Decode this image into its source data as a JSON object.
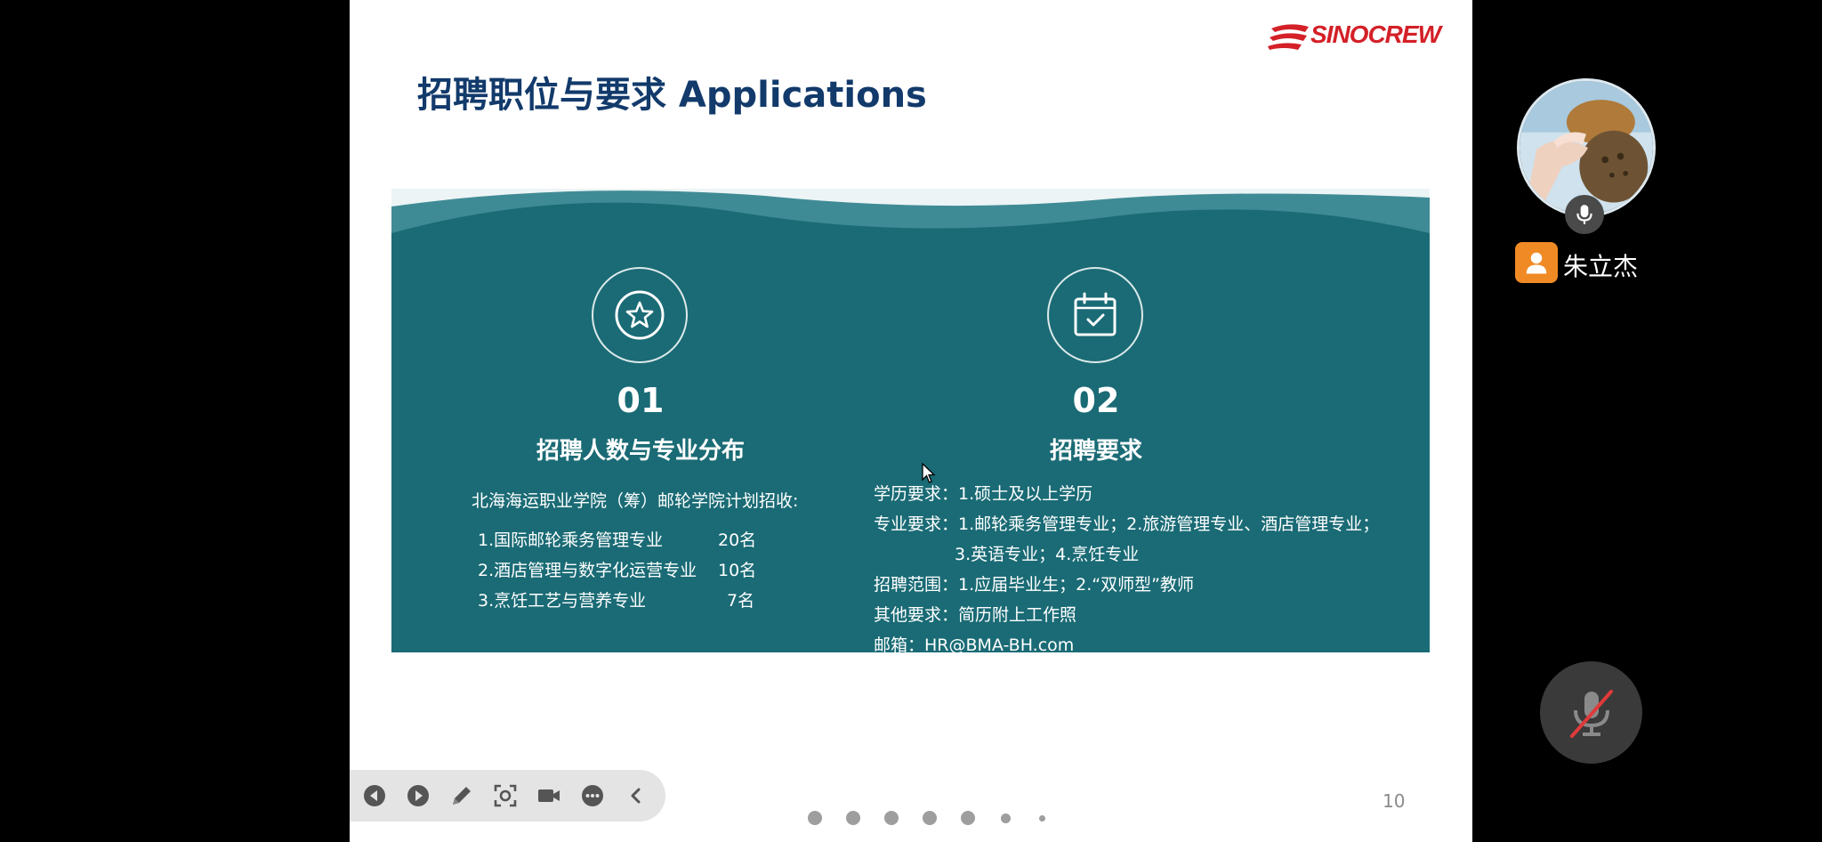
{
  "slide": {
    "brand": "SINOCREW",
    "title": "招聘职位与要求 Applications",
    "page_number": "10",
    "columns": [
      {
        "icon": "star-icon",
        "number": "01",
        "heading": "招聘人数与专业分布",
        "intro": "北海海运职业学院（筹）邮轮学院计划招收:",
        "rows": [
          {
            "major": "1.国际邮轮乘务管理专业",
            "count": "20名"
          },
          {
            "major": "2.酒店管理与数字化运营专业",
            "count": "10名"
          },
          {
            "major": "3.烹饪工艺与营养专业",
            "count": "7名"
          }
        ]
      },
      {
        "icon": "calendar-check-icon",
        "number": "02",
        "heading": "招聘要求",
        "requirements": [
          "学历要求：1.硕士及以上学历",
          "专业要求：1.邮轮乘务管理专业；2.旅游管理专业、酒店管理专业；",
          "3.英语专业；4.烹饪专业",
          "招聘范围：1.应届毕业生；2.“双师型”教师",
          "其他要求：简历附上工作照",
          "邮箱：HR@BMA-BH.com"
        ]
      }
    ],
    "colors": {
      "panel": "#1a6b75",
      "title": "#123a6b",
      "brand": "#d42027"
    }
  },
  "toolbar": {
    "buttons": [
      "previous-icon",
      "next-icon",
      "pen-icon",
      "screenshot-icon",
      "camera-icon",
      "more-icon",
      "collapse-icon"
    ]
  },
  "pager": {
    "dots": 7,
    "current": 0
  },
  "participant": {
    "name": "朱立杰",
    "mic": "microphone-icon"
  },
  "controls": {
    "mute_icon": "microphone-muted-icon"
  }
}
